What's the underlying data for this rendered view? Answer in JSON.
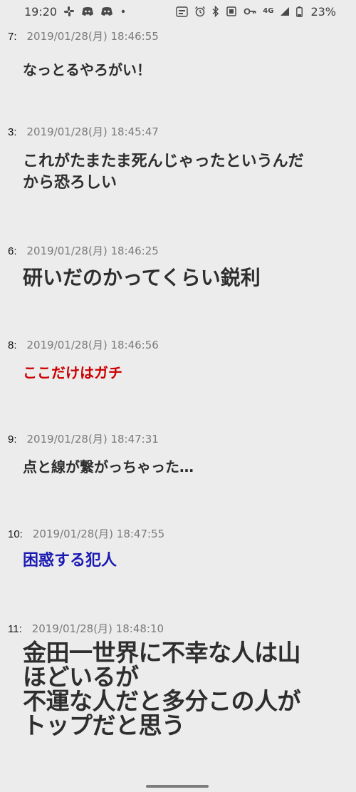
{
  "status_bar": {
    "time": "19:20",
    "network": "4G",
    "battery": "23%",
    "left_icons": [
      "slack-icon",
      "discord-icon",
      "discord-icon",
      "dot-icon"
    ],
    "right_icons": [
      "nfc-auto-icon",
      "alarm-icon",
      "bluetooth-icon",
      "vibrate-icon",
      "key-icon",
      "network-4g-icon",
      "signal-icon",
      "battery-icon"
    ]
  },
  "posts": [
    {
      "num": "7:",
      "date": "2019/01/28(月) 18:46:55",
      "text": "なっとるやろがい！"
    },
    {
      "num": "3:",
      "date": "2019/01/28(月) 18:45:47",
      "text": "これがたまたま死んじゃったというんだ\nから恐ろしい"
    },
    {
      "num": "6:",
      "date": "2019/01/28(月) 18:46:25",
      "text": "研いだのかってくらい鋭利"
    },
    {
      "num": "8:",
      "date": "2019/01/28(月) 18:46:56",
      "text": "ここだけはガチ",
      "color": "#cc0000"
    },
    {
      "num": "9:",
      "date": "2019/01/28(月) 18:47:31",
      "text": "点と線が繋がっちゃった…"
    },
    {
      "num": "10:",
      "date": "2019/01/28(月) 18:47:55",
      "text": "困惑する犯人",
      "color": "#1b1bb3"
    },
    {
      "num": "11:",
      "date": "2019/01/28(月) 18:48:10",
      "text": "金田一世界に不幸な人は山\nほどいるが\n不運な人だと多分この人が\nトップだと思う"
    }
  ]
}
